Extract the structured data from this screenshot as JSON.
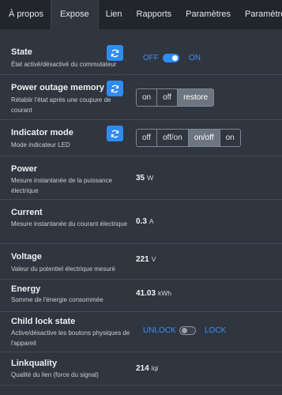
{
  "tabs": [
    "À propos",
    "Expose",
    "Lien",
    "Rapports",
    "Paramètres",
    "Paramètres (s"
  ],
  "rows": {
    "state": {
      "name": "State",
      "desc": "État activé/désactivé du commutateur",
      "off_label": "OFF",
      "on_label": "ON",
      "toggle_on": true
    },
    "power_outage": {
      "name": "Power outage memory",
      "desc": "Rétablir l'état après une coupure de courant",
      "options": [
        "on",
        "off",
        "restore"
      ],
      "selected": "restore"
    },
    "indicator": {
      "name": "Indicator mode",
      "desc": "Mode indicateur LED",
      "options": [
        "off",
        "off/on",
        "on/off",
        "on"
      ],
      "selected": "on/off"
    },
    "power": {
      "name": "Power",
      "desc": "Mesure instantanée de la puissance électrique",
      "value": "35",
      "unit": "W"
    },
    "current": {
      "name": "Current",
      "desc": "Mesure instantanée du courant électrique",
      "value": "0.3",
      "unit": "A"
    },
    "voltage": {
      "name": "Voltage",
      "desc": "Valeur du potentiel électrique mesuré",
      "value": "221",
      "unit": "V"
    },
    "energy": {
      "name": "Energy",
      "desc": "Somme de l'énergie consommée",
      "value": "41.03",
      "unit": "kWh"
    },
    "child_lock": {
      "name": "Child lock state",
      "desc": "Active/désactive les boutons physiques de l'appareil",
      "unlock_label": "UNLOCK",
      "lock_label": "LOCK",
      "toggle_on": false
    },
    "linkquality": {
      "name": "Linkquality",
      "desc": "Qualité du lien (force du signal)",
      "value": "214",
      "unit": "lqi"
    }
  },
  "colors": {
    "background": "#30363f",
    "tabbar": "#22262c",
    "accent": "#2f8cf2",
    "toggle_label": "#3d8ef7",
    "selected_option": "#6d7581"
  },
  "icons": {
    "refresh": "refresh-icon"
  }
}
